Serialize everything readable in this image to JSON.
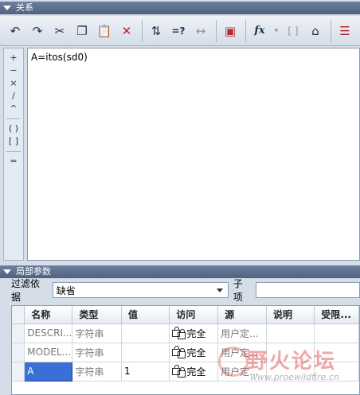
{
  "relations_panel": {
    "title": "关系",
    "toolbar": [
      {
        "name": "undo-icon",
        "glyph": "↶"
      },
      {
        "name": "redo-icon",
        "glyph": "↷"
      },
      {
        "name": "cut-icon",
        "glyph": "✂"
      },
      {
        "name": "copy-icon",
        "glyph": "❐"
      },
      {
        "name": "paste-icon",
        "glyph": "📋"
      },
      {
        "name": "delete-icon",
        "glyph": "✕"
      },
      {
        "name": "sort-relations-icon",
        "glyph": "⇅"
      },
      {
        "name": "evaluate-icon",
        "glyph": "=?"
      },
      {
        "name": "measure-icon",
        "glyph": "↔"
      },
      {
        "name": "verify-relations-icon",
        "glyph": "▣"
      },
      {
        "name": "function-icon",
        "glyph": "fx"
      },
      {
        "name": "brackets-icon",
        "glyph": "[ ]"
      },
      {
        "name": "parameter-icon",
        "glyph": "⌂"
      },
      {
        "name": "show-info-icon",
        "glyph": "☰"
      }
    ],
    "operators": [
      "+",
      "−",
      "×",
      "/",
      "^",
      "( )",
      "[ ]",
      "="
    ],
    "editor_text": "A=itos(sd0)"
  },
  "local_params_panel": {
    "title": "局部参数",
    "filter_label": "过滤依据",
    "filter_value": "缺省",
    "sub_label": "子项",
    "sub_value": "",
    "columns": [
      "名称",
      "类型",
      "值",
      "访问",
      "源",
      "说明",
      "受限..."
    ],
    "rows": [
      {
        "name": "DESCRI...",
        "type": "字符串",
        "value": "",
        "access": "完全",
        "source": "用户定...",
        "desc": "",
        "restricted": ""
      },
      {
        "name": "MODEL...",
        "type": "字符串",
        "value": "",
        "access": "完全",
        "source": "用户定...",
        "desc": "",
        "restricted": ""
      },
      {
        "name": "A",
        "type": "字符串",
        "value": "1",
        "access": "完全",
        "source": "用户定...",
        "desc": "",
        "restricted": ""
      }
    ]
  },
  "watermark": {
    "title": "野火论坛",
    "url": "www.proewildfire.cn"
  }
}
